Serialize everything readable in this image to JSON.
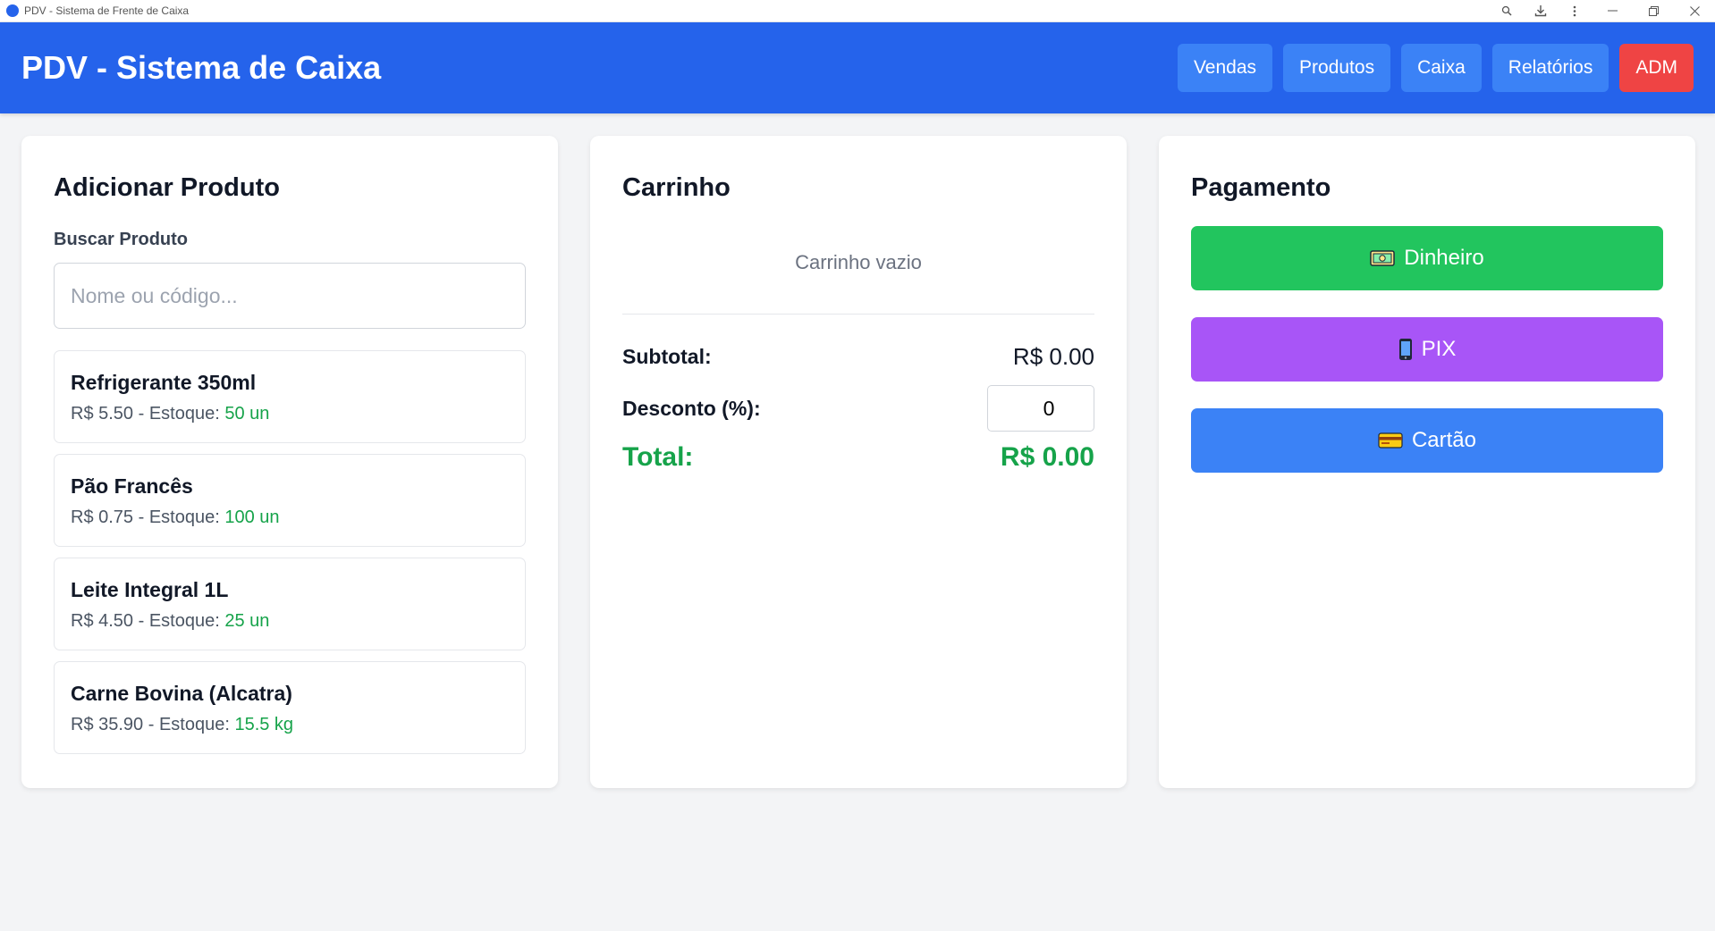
{
  "window": {
    "title": "PDV - Sistema de Frente de Caixa",
    "controls": [
      "zoom-icon",
      "download-icon",
      "more-vert-icon",
      "minimize-icon",
      "restore-icon",
      "close-icon"
    ]
  },
  "header": {
    "title": "PDV - Sistema de Caixa",
    "nav": [
      {
        "label": "Vendas"
      },
      {
        "label": "Produtos"
      },
      {
        "label": "Caixa"
      },
      {
        "label": "Relatórios"
      },
      {
        "label": "ADM"
      }
    ],
    "colors": {
      "background": "#2563eb",
      "nav_button": "#3b82f6",
      "adm_button": "#ef4444"
    }
  },
  "add_product": {
    "title": "Adicionar Produto",
    "search_label": "Buscar Produto",
    "search_placeholder": "Nome ou código...",
    "search_value": "",
    "products": [
      {
        "name": "Refrigerante 350ml",
        "price": "R$ 5.50",
        "stock_label": " - Estoque: ",
        "stock": "50 un"
      },
      {
        "name": "Pão Francês",
        "price": "R$ 0.75",
        "stock_label": " - Estoque: ",
        "stock": "100 un"
      },
      {
        "name": "Leite Integral 1L",
        "price": "R$ 4.50",
        "stock_label": " - Estoque: ",
        "stock": "25 un"
      },
      {
        "name": "Carne Bovina (Alcatra)",
        "price": "R$ 35.90",
        "stock_label": " - Estoque: ",
        "stock": "15.5 kg"
      }
    ]
  },
  "cart": {
    "title": "Carrinho",
    "empty_text": "Carrinho vazio",
    "subtotal_label": "Subtotal:",
    "subtotal_value": "R$ 0.00",
    "discount_label": "Desconto (%):",
    "discount_value": "0",
    "total_label": "Total:",
    "total_value": "R$ 0.00"
  },
  "payment": {
    "title": "Pagamento",
    "methods": [
      {
        "label": "Dinheiro",
        "icon": "money-icon",
        "color": "#22c55e"
      },
      {
        "label": "PIX",
        "icon": "phone-icon",
        "color": "#a855f7"
      },
      {
        "label": "Cartão",
        "icon": "credit-card-icon",
        "color": "#3b82f6"
      }
    ]
  }
}
